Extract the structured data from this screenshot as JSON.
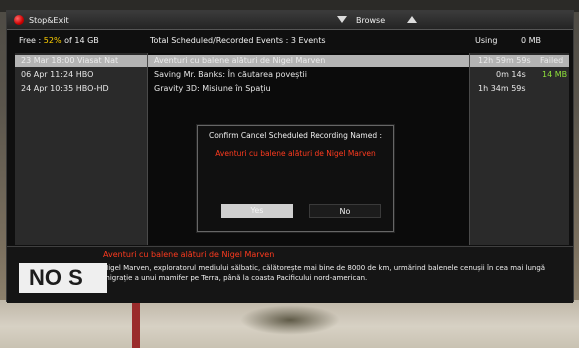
{
  "topbar": {
    "stop_exit_label": "Stop&Exit",
    "browse_label": "Browse"
  },
  "header": {
    "free_prefix": "Free :",
    "free_percent": "52%",
    "free_suffix": "of  14 GB",
    "total_label": "Total Scheduled/Recorded Events :  3 Events",
    "using_label": "Using",
    "using_value": "0 MB"
  },
  "events": [
    {
      "datetime_channel": "23 Mar 18:00  Viasat Nat",
      "title": "Aventuri cu balene alături de Nigel Marven",
      "duration": "12h 59m 59s",
      "size": "Failed",
      "selected": true
    },
    {
      "datetime_channel": "06 Apr 11:24  HBO",
      "title": "Saving Mr. Banks: În căutarea poveștii",
      "duration": "0m 14s",
      "size": "14 MB",
      "selected": false
    },
    {
      "datetime_channel": "24 Apr 10:35  HBO-HD",
      "title": "Gravity 3D: Misiune în Spațiu",
      "duration": "1h 34m 59s",
      "size": "",
      "selected": false
    }
  ],
  "dialog": {
    "title": "Confirm Cancel Scheduled Recording Named :",
    "recording_name": "Aventuri cu balene alături de Nigel Marven",
    "yes_label": "Yes",
    "no_label": "No"
  },
  "info": {
    "sign_text": "NO S",
    "title": "Aventuri cu balene alături de Nigel Marven",
    "description": "Nigel Marven, exploratorul mediului sălbatic, călătorește mai bine de 8000 de km, urmărind balenele cenușii în cea mai lungă migrație a unui mamifer pe Terra, până la coasta Pacificului nord-american."
  },
  "colors": {
    "accent_red": "#ff3b1f",
    "percent_yellow": "#ffd000",
    "size_green": "#8fe23a"
  }
}
